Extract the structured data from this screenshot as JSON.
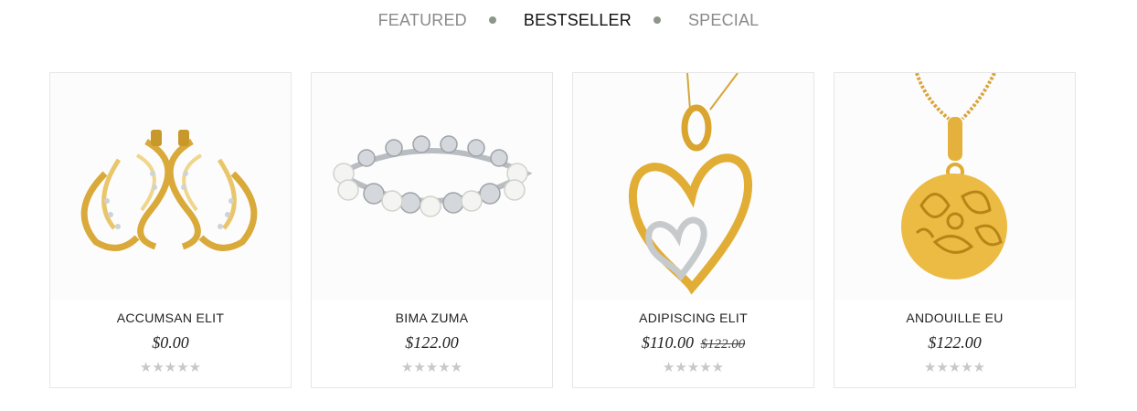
{
  "tabs": [
    {
      "label": "FEATURED",
      "active": false
    },
    {
      "label": "BESTSELLER",
      "active": true
    },
    {
      "label": "SPECIAL",
      "active": false
    }
  ],
  "products": [
    {
      "name": "ACCUMSAN ELIT",
      "price": "$0.00",
      "old_price": "",
      "rating": 0,
      "image_icon": "gold-earrings-icon"
    },
    {
      "name": "BIMA ZUMA",
      "price": "$122.00",
      "old_price": "",
      "rating": 0,
      "image_icon": "pearl-bracelet-icon"
    },
    {
      "name": "ADIPISCING ELIT",
      "price": "$110.00",
      "old_price": "$122.00",
      "rating": 0,
      "image_icon": "heart-pendant-icon"
    },
    {
      "name": "ANDOUILLE EU",
      "price": "$122.00",
      "old_price": "",
      "rating": 0,
      "image_icon": "round-pendant-icon"
    }
  ],
  "colors": {
    "gold": "#e2b23c",
    "gold_dark": "#b8861f",
    "silver": "#c9ccd0",
    "star_empty": "#c8c8c8",
    "dot": "#8e968c"
  }
}
